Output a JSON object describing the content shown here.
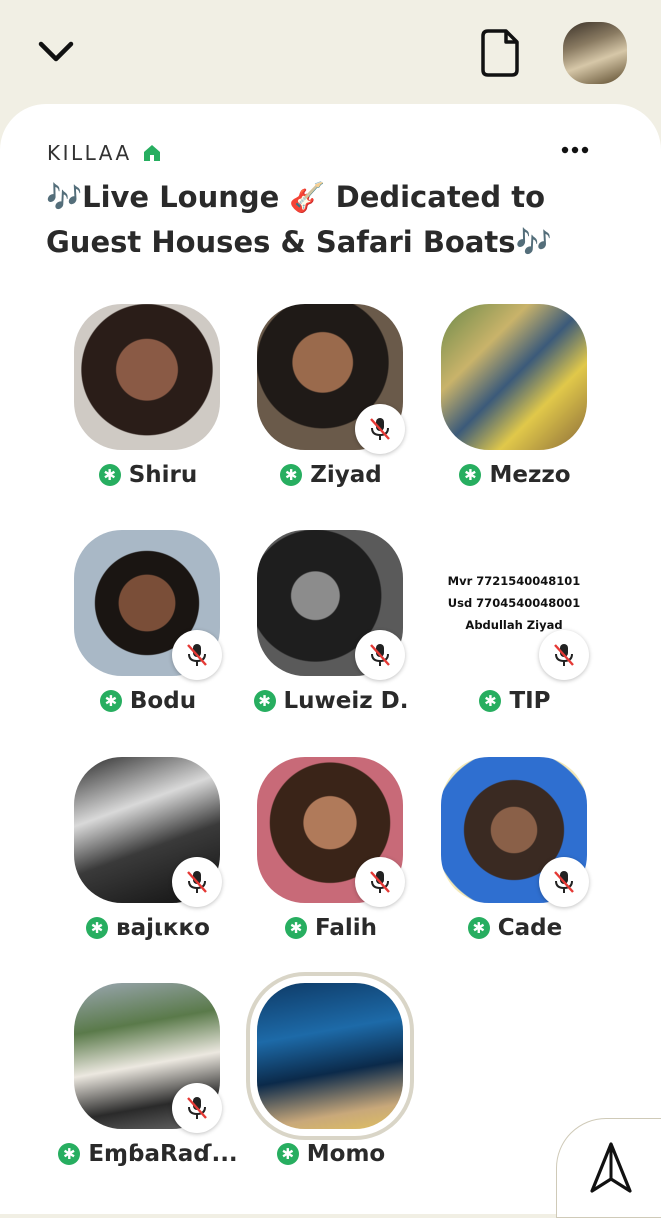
{
  "header": {
    "back_icon": "chevron-down-icon",
    "doc_icon": "document-icon"
  },
  "room": {
    "club_name": "KILLAA",
    "title": "🎶Live Lounge 🎸 Dedicated to Guest Houses & Safari Boats🎶"
  },
  "colors": {
    "background": "#f1efe4",
    "card": "#ffffff",
    "moderator_badge": "#27ae60",
    "mute_slash": "#e53935"
  },
  "tip_card": {
    "line1": "Mvr 7721540048101",
    "line2": "Usd 7704540048001",
    "line3": "Abdullah Ziyad"
  },
  "speakers": [
    {
      "name": "Shiru",
      "muted": false
    },
    {
      "name": "Ziyad",
      "muted": true
    },
    {
      "name": "Mezzo",
      "muted": false
    },
    {
      "name": "Bodu",
      "muted": true
    },
    {
      "name": "Luweiz D.",
      "muted": true
    },
    {
      "name": "TIP",
      "muted": true
    },
    {
      "name": "вајιккo",
      "muted": true
    },
    {
      "name": "Falih",
      "muted": true
    },
    {
      "name": "Cade",
      "muted": true
    },
    {
      "name": "EɱɓaRaɗ...",
      "muted": true
    },
    {
      "name": "Momo",
      "muted": false
    }
  ]
}
